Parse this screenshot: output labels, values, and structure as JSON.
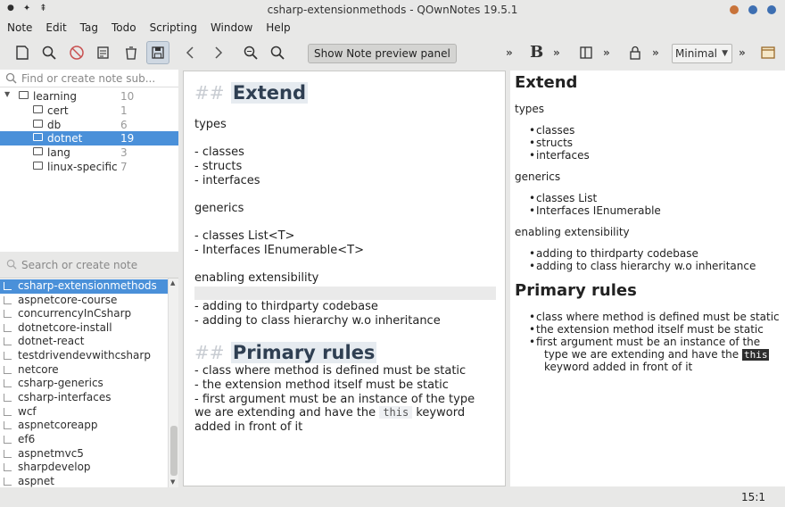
{
  "window": {
    "title": "csharp-extensionmethods - QOwnNotes 19.5.1",
    "controls": {
      "minimize_color": "#c8733a",
      "maximize_color": "#3d6fb2",
      "close_color": "#3d6fb2"
    }
  },
  "menu": [
    "Note",
    "Edit",
    "Tag",
    "Todo",
    "Scripting",
    "Window",
    "Help"
  ],
  "toolbar": {
    "preview_button": "Show Note preview panel",
    "chevron": "»",
    "bold": "B",
    "mode_select": "Minimal"
  },
  "subfolder_search": {
    "placeholder": "Find or create note sub..."
  },
  "subfolders": [
    {
      "name": "learning",
      "count": "10"
    },
    {
      "name": "cert",
      "count": "1"
    },
    {
      "name": "db",
      "count": "6"
    },
    {
      "name": "dotnet",
      "count": "19"
    },
    {
      "name": "lang",
      "count": "3"
    },
    {
      "name": "linux-specific",
      "count": "7"
    }
  ],
  "note_search": {
    "placeholder": "Search or create note"
  },
  "notes": [
    "csharp-extensionmethods",
    "aspnetcore-course",
    "concurrencyInCsharp",
    "dotnetcore-install",
    "dotnet-react",
    "testdrivendevwithcsharp",
    "netcore",
    "csharp-generics",
    "csharp-interfaces",
    "wcf",
    "aspnetcoreapp",
    "ef6",
    "aspnetmvc5",
    "sharpdevelop",
    "aspnet"
  ],
  "editor": {
    "hash": "##",
    "h1": "Extend",
    "types": "types",
    "types_items": [
      "- classes",
      "- structs",
      "- interfaces"
    ],
    "generics": "generics",
    "generics_items": [
      "- classes List<T>",
      "- Interfaces IEnumerable<T>"
    ],
    "extensibility": "enabling extensibility",
    "extensibility_items": [
      "- adding to thirdparty codebase",
      "- adding to class hierarchy w.o inheritance"
    ],
    "h2": "Primary rules",
    "rules": [
      "- class where method is defined must be static",
      "- the extension method itself must be static",
      "- first argument must be an instance of the type"
    ],
    "rule_cont_a": "we are extending and have the",
    "rule_code": "this",
    "rule_cont_b": "keyword",
    "rule_cont_c": "added in front of it"
  },
  "preview": {
    "h1": "Extend",
    "types": "types",
    "types_items": [
      "classes",
      "structs",
      "interfaces"
    ],
    "generics": "generics",
    "generics_items": [
      "classes List",
      "Interfaces IEnumerable"
    ],
    "extensibility": "enabling extensibility",
    "extensibility_items": [
      "adding to thirdparty codebase",
      "adding to class hierarchy w.o inheritance"
    ],
    "h2": "Primary rules",
    "rules": [
      "class where method is defined must be static",
      "the extension method itself must be static",
      "first argument must be an instance of the"
    ],
    "rule_cont_a": "type we are extending and have the",
    "rule_code": "this",
    "rule_cont_b": "keyword added in front of it"
  },
  "status": {
    "cursor": "15:1"
  }
}
